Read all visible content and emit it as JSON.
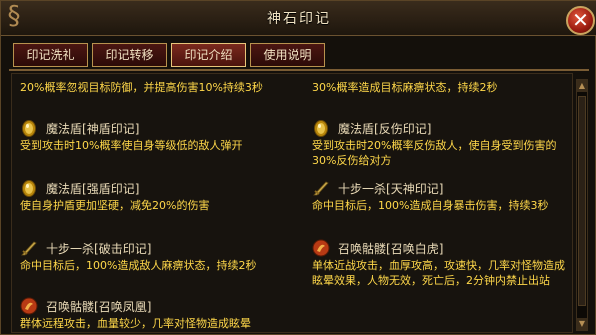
{
  "window": {
    "title": "神石印记",
    "close_label": "✕"
  },
  "tabs": [
    {
      "label": "印记洗礼",
      "active": false
    },
    {
      "label": "印记转移",
      "active": false
    },
    {
      "label": "印记介绍",
      "active": true
    },
    {
      "label": "使用说明",
      "active": false
    }
  ],
  "entries": {
    "top_left_desc": "20%概率忽视目标防御，并提高伤害10%持续3秒",
    "top_right_desc": "30%概率造成目标麻痹状态，持续2秒",
    "shendun": {
      "name": "魔法盾",
      "mark": "[神盾印记]",
      "desc": "受到攻击时10%概率使自身等级低的敌人弹开",
      "icon": "egg-shield-icon"
    },
    "fanshang": {
      "name": "魔法盾",
      "mark": "[反伤印记]",
      "desc": "受到攻击时20%概率反伤敌人，使自身受到伤害的30%反伤给对方",
      "icon": "egg-shield-icon"
    },
    "qiangdun": {
      "name": "魔法盾",
      "mark": "[强盾印记]",
      "desc": "使自身护盾更加坚硬，减免20%的伤害",
      "icon": "egg-shield-icon"
    },
    "tianshen": {
      "name": "十步一杀",
      "mark": "[天神印记]",
      "desc": "命中目标后，100%造成自身暴击伤害，持续3秒",
      "icon": "blade-icon"
    },
    "pobai": {
      "name": "十步一杀",
      "mark": "[破击印记]",
      "desc": "命中目标后，100%造成敌人麻痹状态，持续2秒",
      "icon": "blade-icon"
    },
    "baihu": {
      "name": "召唤骷髅",
      "mark": "[召唤白虎]",
      "desc": "单体近战攻击，血厚攻高，攻速快，几率对怪物造成眩晕效果，人物无效，死亡后，2分钟内禁止出站",
      "icon": "skull-summon-icon"
    },
    "fenghuang": {
      "name": "召唤骷髅",
      "mark": "[召唤凤凰]",
      "desc": "群体远程攻击，血量较少，几率对怪物造成眩晕",
      "icon": "skull-summon-icon"
    }
  }
}
